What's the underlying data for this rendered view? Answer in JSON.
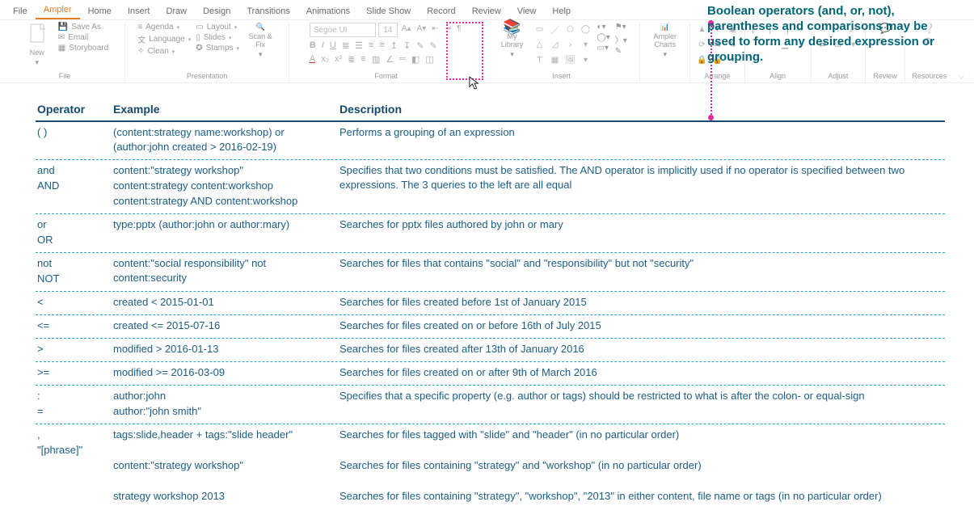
{
  "callout_text": "Boolean operators (and, or, not), parentheses and comparisons may be used to form any desired expression or grouping.",
  "tabs": [
    "File",
    "Ampler",
    "Home",
    "Insert",
    "Draw",
    "Design",
    "Transitions",
    "Animations",
    "Slide Show",
    "Record",
    "Review",
    "View",
    "Help"
  ],
  "file_group": {
    "new": "New",
    "save_as": "Save As",
    "email": "Email",
    "storyboard": "Storyboard",
    "label": "File"
  },
  "presentation_group": {
    "agenda": "Agenda",
    "language": "Language",
    "clean": "Clean",
    "layout": "Layout",
    "slides": "Slides",
    "stamps": "Stamps",
    "scan_fix": "Scan & Fix",
    "label": "Presentation"
  },
  "format_group": {
    "font_name": "Segoe UI",
    "font_size": "14",
    "label": "Format"
  },
  "insert_group": {
    "my_library": "My Library",
    "label": "Insert"
  },
  "ampler_charts_group": {
    "ampler_charts": "Ampler Charts",
    "label": ""
  },
  "arrange_group": {
    "label": "Arrange"
  },
  "align_group": {
    "label": "Align"
  },
  "adjust_group": {
    "label": "Adjust"
  },
  "review_group": {
    "label": "Review"
  },
  "resources_group": {
    "label": "Resources"
  },
  "table_head": {
    "c1": "Operator",
    "c2": "Example",
    "c3": "Description"
  },
  "rows": [
    {
      "op": [
        "( )"
      ],
      "ex": [
        "(content:strategy name:workshop) or (author:john created > 2016-02-19)"
      ],
      "desc": [
        "Performs a grouping of an expression"
      ]
    },
    {
      "op": [
        "and",
        "AND"
      ],
      "ex": [
        "content:\"strategy workshop\"",
        "content:strategy content:workshop",
        "content:strategy AND content:workshop"
      ],
      "desc": [
        "Specifies that two conditions must be satisfied. The AND operator is implicitly used if no operator is specified between two expressions. The 3 queries to the left are all equal"
      ]
    },
    {
      "op": [
        "or",
        "OR"
      ],
      "ex": [
        "type:pptx (author:john or author:mary)"
      ],
      "desc": [
        "Searches for pptx files authored by john or mary"
      ]
    },
    {
      "op": [
        "not",
        "NOT"
      ],
      "ex": [
        "content:\"social responsibility\" not content:security"
      ],
      "desc": [
        "Searches for files that contains \"social\" and \"responsibility\" but not \"security\""
      ]
    },
    {
      "op": [
        "<"
      ],
      "ex": [
        "created < 2015-01-01"
      ],
      "desc": [
        "Searches for files created before 1st of January 2015"
      ]
    },
    {
      "op": [
        "<="
      ],
      "ex": [
        "created <= 2015-07-16"
      ],
      "desc": [
        "Searches for files created on or before 16th of July 2015"
      ]
    },
    {
      "op": [
        ">"
      ],
      "ex": [
        "modified > 2016-01-13"
      ],
      "desc": [
        "Searches for files created after 13th of January 2016"
      ]
    },
    {
      "op": [
        ">="
      ],
      "ex": [
        "modified >= 2016-03-09"
      ],
      "desc": [
        "Searches for files created on or after 9th of March 2016"
      ]
    },
    {
      "op": [
        ":",
        "="
      ],
      "ex": [
        "author:john",
        "author:\"john smith\""
      ],
      "desc": [
        "Specifies that a specific property (e.g. author or tags) should be restricted to what is after the colon- or equal-sign"
      ]
    },
    {
      "op": [
        ",",
        "\"[phrase]\""
      ],
      "ex": [
        "tags:slide,header + tags:\"slide header\"",
        "",
        "content:\"strategy workshop\"",
        "",
        "strategy workshop 2013"
      ],
      "desc": [
        "Searches for files tagged with \"slide\" and \"header\" (in no particular order)",
        "",
        "Searches for files containing \"strategy\" and \"workshop\" (in no particular order)",
        "",
        "Searches for files containing \"strategy\", \"workshop\", \"2013\" in either content, file name or tags (in no particular order)"
      ]
    }
  ]
}
